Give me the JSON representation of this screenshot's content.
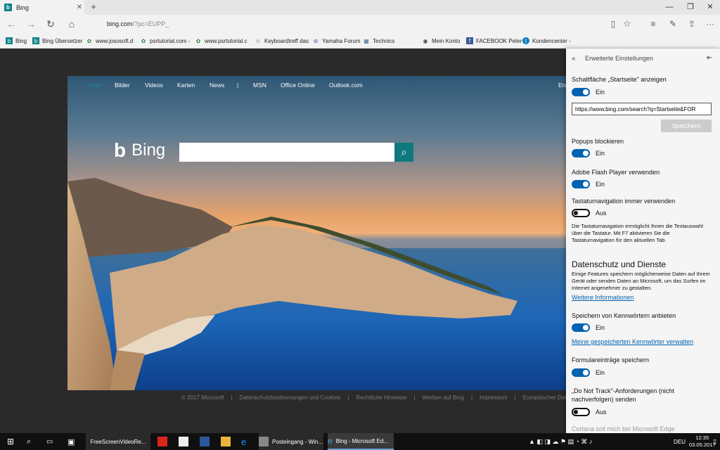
{
  "tab": {
    "title": "Bing",
    "favicon": "b"
  },
  "address": {
    "host": "bing.com",
    "path": "/?pc=EUPP_"
  },
  "favorites": [
    {
      "label": "Bing",
      "icon": "bing-icon",
      "color": "#0f8387"
    },
    {
      "label": "Bing Übersetzer",
      "icon": "bing-icon",
      "color": "#0f8387"
    },
    {
      "label": "www.jososoft.d",
      "icon": "puzzle-icon",
      "color": "#2e8b3e"
    },
    {
      "label": "psrtutorial.com -",
      "icon": "puzzle-icon",
      "color": "#2e8b3e"
    },
    {
      "label": "www.psrtutorial.c",
      "icon": "puzzle-icon",
      "color": "#2e8b3e"
    },
    {
      "label": "Keyboardtreff das",
      "icon": "star-icon",
      "color": "#444"
    },
    {
      "label": "Yamaha Forum",
      "icon": "yamaha-icon",
      "color": "#7b3fa0"
    },
    {
      "label": "Technics",
      "icon": "grid-icon",
      "color": "#4a6a9a"
    },
    {
      "label": "Mein Konto",
      "icon": "globe-icon",
      "color": "#444"
    },
    {
      "label": "FACEBOOK  Peter",
      "icon": "facebook-icon",
      "color": "#3b5998"
    },
    {
      "label": "Kundencenter -",
      "icon": "telekom-icon",
      "color": "#0a7bc0"
    }
  ],
  "bing_nav": [
    "Bilder",
    "Videos",
    "Karten",
    "News",
    "|",
    "MSN",
    "Office Online",
    "Outlook.com"
  ],
  "bing_logo": "Bing",
  "bing_nav_right": "Eng",
  "footer": [
    "© 2017 Microsoft",
    "|",
    "Datenschutzbestimmungen und Cookies",
    "|",
    "Rechtliche Hinweise",
    "|",
    "Werben auf Bing",
    "|",
    "Impressum",
    "|",
    "Europäischer Datensch"
  ],
  "panel": {
    "header": "Erweiterte Einstellungen",
    "home_label": "Schaltfläche „Startseite\" anzeigen",
    "home_state": "Ein",
    "home_url": "https://www.bing.com/search?q=Startseite&FOR",
    "save_button": "Speichern",
    "popups_label": "Popups blockieren",
    "popups_state": "Ein",
    "flash_label": "Adobe Flash Player verwenden",
    "flash_state": "Ein",
    "caret_label": "Tastaturnavigation immer verwenden",
    "caret_state": "Aus",
    "caret_desc": "Die Tastaturnavigation ermöglicht Ihnen die Textauswahl über die Tastatur. Mit F7 aktivieren Sie die Tastaturnavigation für den aktuellen Tab.",
    "privacy_heading": "Datenschutz und Dienste",
    "privacy_desc": "Einige Features speichern möglicherweise Daten auf Ihrem Gerät oder senden Daten an Microsoft, um das Surfen im Internet angenehmer zu gestalten.",
    "more_info": "Weitere Informationen",
    "passwords_label": "Speichern von Kennwörtern anbieten",
    "passwords_state": "Ein",
    "passwords_link": "Meine gespeicherten Kennwörter verwalten",
    "forms_label": "Formulareinträge speichern",
    "forms_state": "Ein",
    "dnt_label": "„Do Not Track\"-Anforderungen (nicht nachverfolgen) senden",
    "dnt_state": "Aus",
    "cortana_label": "Cortana soll mich bei Microsoft Edge"
  },
  "taskbar": {
    "apps": [
      "FreeScreenVideoRe...",
      "Posteingang - Win...",
      "Bing - Microsoft Ed..."
    ],
    "lang": "DEU",
    "time": "12:35",
    "date": "03.05.2017"
  }
}
